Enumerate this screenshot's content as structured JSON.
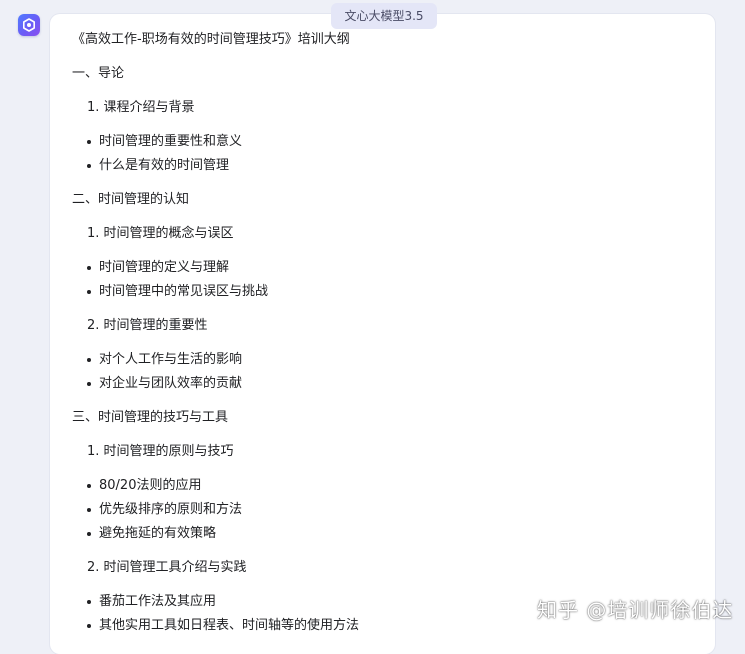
{
  "header": {
    "model_label": "文心大模型3.5"
  },
  "icons": {
    "avatar": "ernie-bot-logo-icon"
  },
  "content": {
    "title": "《高效工作-职场有效的时间管理技巧》培训大纲",
    "sections": [
      {
        "heading": "一、导论",
        "subsections": [
          {
            "heading": "1. 课程介绍与背景",
            "bullets": [
              "时间管理的重要性和意义",
              "什么是有效的时间管理"
            ]
          }
        ]
      },
      {
        "heading": "二、时间管理的认知",
        "subsections": [
          {
            "heading": "1. 时间管理的概念与误区",
            "bullets": [
              "时间管理的定义与理解",
              "时间管理中的常见误区与挑战"
            ]
          },
          {
            "heading": "2. 时间管理的重要性",
            "bullets": [
              "对个人工作与生活的影响",
              "对企业与团队效率的贡献"
            ]
          }
        ]
      },
      {
        "heading": "三、时间管理的技巧与工具",
        "subsections": [
          {
            "heading": "1. 时间管理的原则与技巧",
            "bullets": [
              "80/20法则的应用",
              "优先级排序的原则和方法",
              "避免拖延的有效策略"
            ]
          },
          {
            "heading": "2. 时间管理工具介绍与实践",
            "bullets": [
              "番茄工作法及其应用",
              "其他实用工具如日程表、时间轴等的使用方法"
            ]
          }
        ]
      }
    ]
  },
  "watermark": "知乎 @培训师徐伯达",
  "colors": {
    "page_background": "#eef0f7",
    "card_background": "#ffffff",
    "model_tag_background": "#e4e6f7",
    "text": "#202124"
  }
}
